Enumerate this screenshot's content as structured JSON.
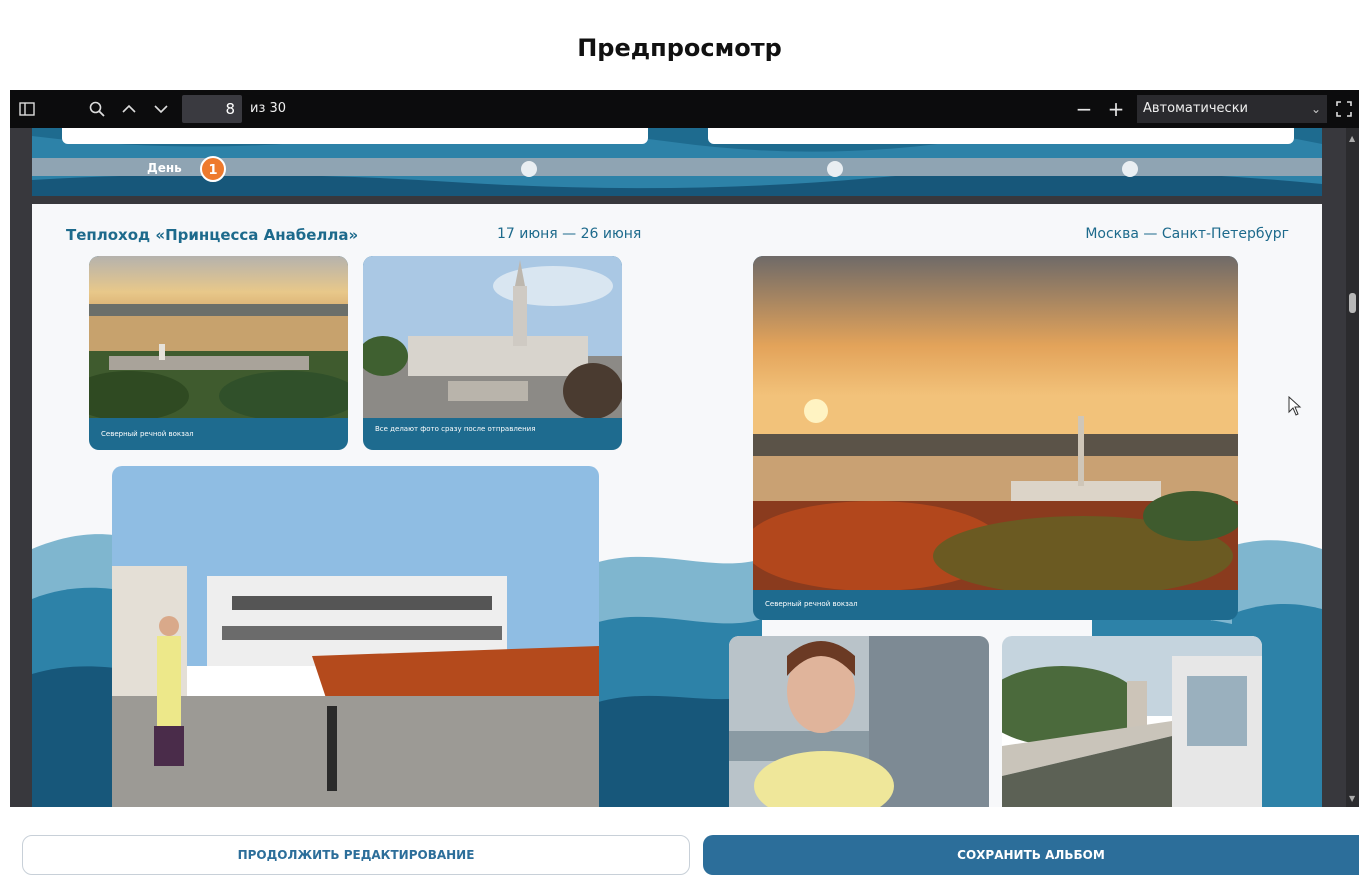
{
  "header": {
    "title": "Предпросмотр"
  },
  "toolbar": {
    "sidebar_icon": "sidebar-toggle-icon",
    "search_icon": "search-icon",
    "prev_icon": "chevron-up-icon",
    "next_icon": "chevron-down-icon",
    "page_number": "8",
    "page_count": "из 30",
    "zoom_out": "−",
    "zoom_in": "+",
    "zoom_value": "Автоматически",
    "fullscreen_icon": "fullscreen-icon"
  },
  "timeline": {
    "day_label": "День",
    "day_number": "1"
  },
  "album_page": {
    "ship": "Теплоход «Принцесса Анабелла»",
    "dates": "17 июня — 26 июня",
    "route": "Москва — Санкт-Петербург",
    "photos": [
      {
        "caption": "Северный речной вокзал"
      },
      {
        "caption": "Все делают фото сразу после отправления"
      },
      {
        "caption": "Северный речной вокзал"
      }
    ]
  },
  "actions": {
    "continue_label": "ПРОДОЛЖИТЬ РЕДАКТИРОВАНИЕ",
    "save_label": "СОХРАНИТЬ АЛЬБОМ"
  },
  "colors": {
    "accent": "#2c6e9a",
    "day_badge": "#ee7a2d",
    "brand_blue": "#1d6a8c"
  }
}
